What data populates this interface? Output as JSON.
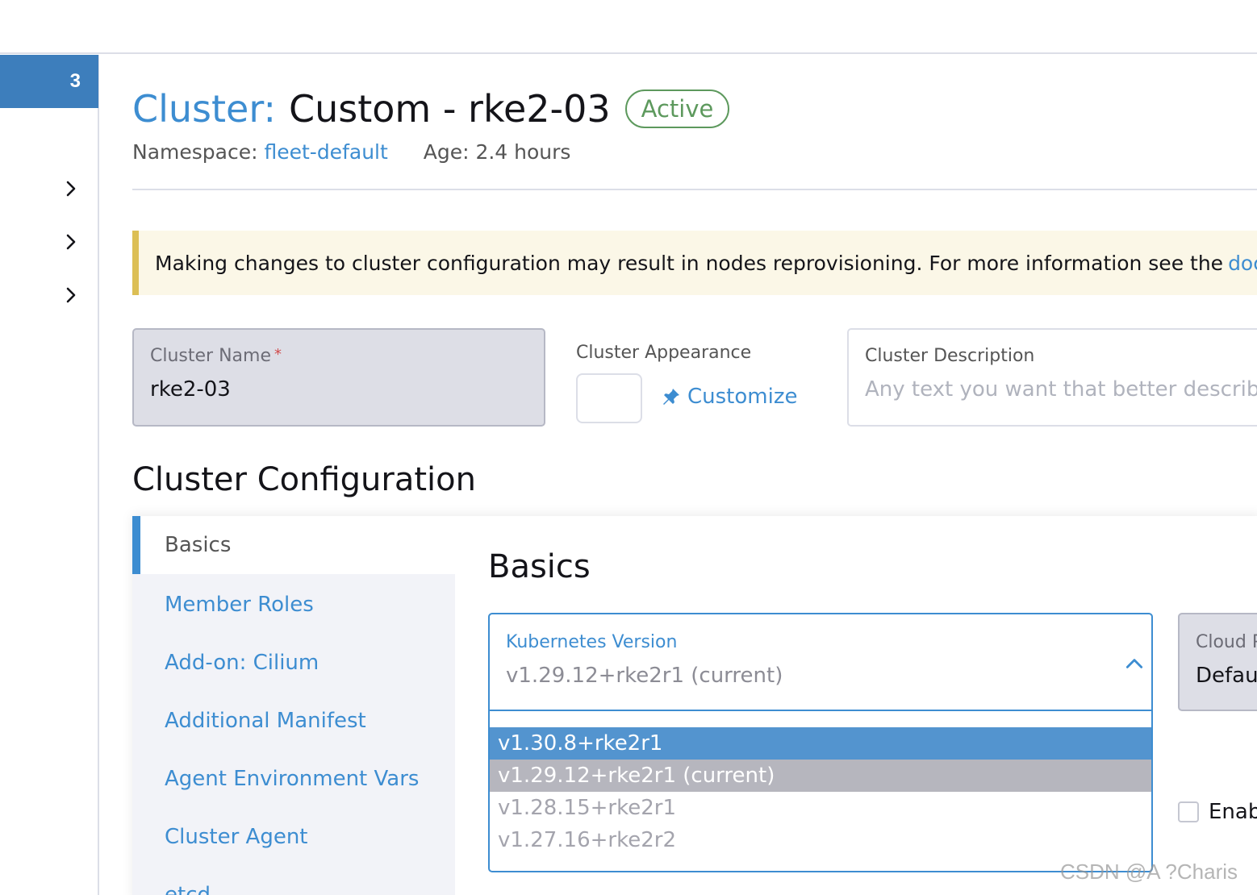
{
  "sidebar": {
    "badge": "3",
    "items": [
      {
        "icon": "chevron-right-icon"
      },
      {
        "icon": "chevron-right-icon"
      },
      {
        "icon": "chevron-right-icon"
      }
    ]
  },
  "header": {
    "title_prefix": "Cluster:",
    "title_name": "Custom - rke2-03",
    "status": "Active",
    "namespace_label": "Namespace:",
    "namespace_value": "fleet-default",
    "age": "Age: 2.4 hours"
  },
  "banner": {
    "text": "Making changes to cluster configuration may result in nodes reprovisioning. For more information see the",
    "link": "documentation"
  },
  "form": {
    "cluster_name_label": "Cluster Name",
    "cluster_name_required": "*",
    "cluster_name_value": "rke2-03",
    "appearance_label": "Cluster Appearance",
    "customize_label": "Customize",
    "description_label": "Cluster Description",
    "description_placeholder": "Any text you want that better describes this cluster"
  },
  "config": {
    "section_title": "Cluster Configuration",
    "tabs": [
      {
        "label": "Basics"
      },
      {
        "label": "Member Roles"
      },
      {
        "label": "Add-on: Cilium"
      },
      {
        "label": "Additional Manifest"
      },
      {
        "label": "Agent Environment Vars"
      },
      {
        "label": "Cluster Agent"
      },
      {
        "label": "etcd"
      }
    ],
    "basics_title": "Basics",
    "k8s_label": "Kubernetes Version",
    "k8s_value": "v1.29.12+rke2r1 (current)",
    "k8s_options": [
      {
        "label": "v1.30.8+rke2r1",
        "state": "highlight"
      },
      {
        "label": "v1.29.12+rke2r1 (current)",
        "state": "current"
      },
      {
        "label": "v1.28.15+rke2r1",
        "state": "normal"
      },
      {
        "label": "v1.27.16+rke2r2",
        "state": "normal"
      }
    ],
    "cloud_label": "Cloud Provider",
    "cloud_value": "Default",
    "enable_label": "Enable"
  },
  "colors": {
    "accent": "#3d8dd1",
    "active_status": "#5d995d",
    "banner_border": "#dcbf55",
    "option_highlight": "#5394cf"
  },
  "watermark": "CSDN @A ?Charis"
}
